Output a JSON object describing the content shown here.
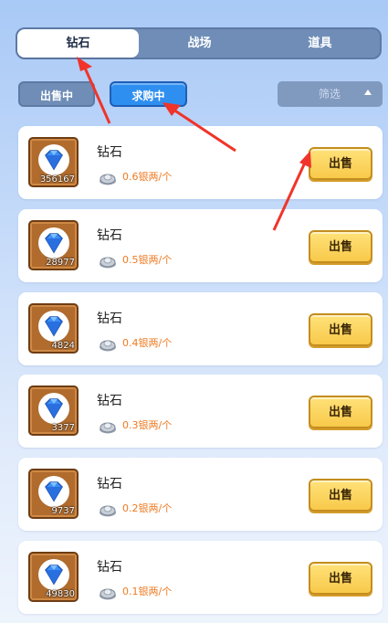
{
  "top_tabs": [
    {
      "label": "钻石",
      "active": true
    },
    {
      "label": "战场",
      "active": false
    },
    {
      "label": "道具",
      "active": false
    }
  ],
  "sub_tabs": {
    "sell": "出售中",
    "buy": "求购中",
    "active": "buy"
  },
  "filter": {
    "label": "筛选"
  },
  "items": [
    {
      "name": "钻石",
      "quantity": "356167",
      "price": "0.6银两/个",
      "action": "出售"
    },
    {
      "name": "钻石",
      "quantity": "28977",
      "price": "0.5银两/个",
      "action": "出售"
    },
    {
      "name": "钻石",
      "quantity": "4824",
      "price": "0.4银两/个",
      "action": "出售"
    },
    {
      "name": "钻石",
      "quantity": "3377",
      "price": "0.3银两/个",
      "action": "出售"
    },
    {
      "name": "钻石",
      "quantity": "9737",
      "price": "0.2银两/个",
      "action": "出售"
    },
    {
      "name": "钻石",
      "quantity": "49830",
      "price": "0.1银两/个",
      "action": "出售"
    }
  ],
  "icons": {
    "item": "diamond-icon",
    "currency": "silver-ingot-icon",
    "filter": "caret-up-icon"
  },
  "colors": {
    "accent": "#2f8ff0",
    "price": "#ef7a22",
    "button": "#f8c94a",
    "annotation": "#f0342a"
  }
}
